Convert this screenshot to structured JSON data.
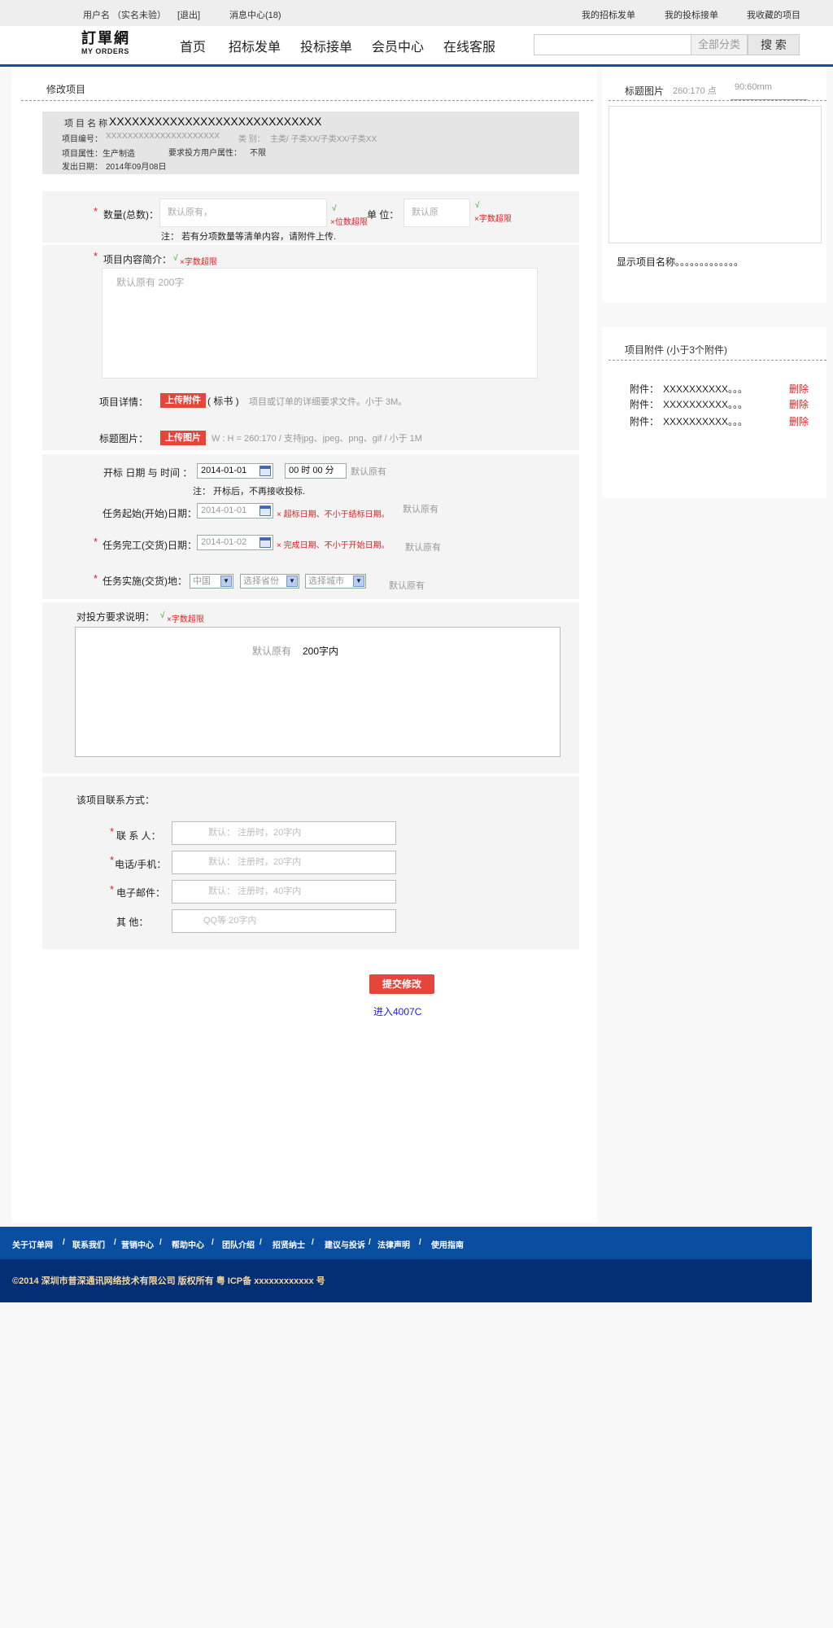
{
  "topbar": {
    "user": "用户名 （实名未验）",
    "logout": "[退出]",
    "messages": "消息中心(18)",
    "my_bids": "我的招标发单",
    "my_tenders": "我的投标接单",
    "favorites": "我收藏的项目"
  },
  "logo": {
    "cn": "訂單網",
    "en": "MY ORDERS"
  },
  "nav": {
    "home": "首页",
    "tender": "招标发单",
    "bid": "投标接单",
    "member": "会员中心",
    "service": "在线客服"
  },
  "search": {
    "placeholder": "",
    "category": "全部分类",
    "button": "搜 索"
  },
  "form": {
    "title": "修改项目",
    "info": {
      "name_label": "项 目 名 称",
      "name_value": "XXXXXXXXXXXXXXXXXXXXXXXXXXXX",
      "no_label": "项目编号：",
      "no_value": "XXXXXXXXXXXXXXXXXXXXX",
      "cat_label": "类 别：",
      "cat_value": "主类/ 子类XX/子类XX/子类XX",
      "attr_label": "项目属性：",
      "attr_value": "生产制造",
      "req_label": "要求投方用户属性：",
      "req_value": "不限",
      "date_label": "发出日期：",
      "date_value": "2014年09月08日"
    },
    "qty": {
      "label": "数量(总数)：",
      "placeholder": "默认原有，",
      "ok": "√",
      "err": "×位数超限",
      "unit_label": "单  位：",
      "unit_placeholder": "默认原",
      "unit_ok": "√",
      "unit_err": "×字数超限",
      "note": "注：  若有分项数量等清单内容，请附件上传."
    },
    "intro": {
      "label": "项目内容简介：",
      "ok": "√",
      "err": "×字数超限",
      "placeholder": "默认原有    200字"
    },
    "detail": {
      "label": "项目详情：",
      "button": "上传附件",
      "suffix": "( 标书 )",
      "hint": "项目或订单的详细要求文件。小于 3M。"
    },
    "image": {
      "label": "标题图片：",
      "button": "上传图片",
      "hint": "W : H = 260:170    / 支持jpg、jpeg、png、gif  /   小于 1M"
    },
    "bid_time": {
      "label": "开标 日期 与 时间 ：",
      "date": "2014-01-01",
      "time": "00 时 00 分",
      "default": "默认原有",
      "note": "注：  开标后，不再接收投标."
    },
    "start": {
      "label": "任务起始(开始)日期：",
      "date": "2014-01-01",
      "err": "× 超标日期、不小于结标日期。",
      "default": "默认原有"
    },
    "finish": {
      "label": "任务完工(交货)日期：",
      "date": "2014-01-02",
      "err": "× 完成日期、不小于开始日期。",
      "default": "默认原有"
    },
    "place": {
      "label": "任务实施(交货)地：",
      "country": "中国",
      "province": "选择省份",
      "city": "选择城市",
      "default": "默认原有"
    },
    "requirement": {
      "label": "对投方要求说明：",
      "ok": "√",
      "err": "×字数超限",
      "placeholder": "默认原有",
      "limit": "200字内"
    },
    "contact": {
      "title": "该项目联系方式：",
      "person": "联  系  人：",
      "person_ph": "默认：  注册时，20字内",
      "phone": "电话/手机：",
      "phone_ph": "默认：  注册时，20字内",
      "email": "电子邮件：",
      "email_ph": "默认：  注册时，40字内",
      "other": "其        他：",
      "other_ph": "QQ等 20字内"
    },
    "submit": "提交修改",
    "link": "进入4007C"
  },
  "side": {
    "image_title": "标题图片",
    "ratio": "260:170 点",
    "size": "90:60mm",
    "caption": "显示项目名称。。。。。。。。。。。。。",
    "attach_title": "项目附件 (小于3个附件)",
    "attachments": [
      {
        "label": "附件：",
        "name": "XXXXXXXXXX。。。",
        "del": "删除"
      },
      {
        "label": "附件：",
        "name": "XXXXXXXXXX。。。",
        "del": "删除"
      },
      {
        "label": "附件：",
        "name": "XXXXXXXXXX。。。",
        "del": "删除"
      }
    ]
  },
  "footer": {
    "links": [
      "关于订单网",
      "/",
      "联系我们",
      "/",
      "营销中心",
      "/",
      "帮助中心",
      "/",
      "团队介绍",
      "/",
      "招贤纳士",
      "/",
      "建议与投诉",
      "/",
      "法律声明",
      "/",
      "使用指南"
    ],
    "copyright": "©2014 深圳市普深通讯网络技术有限公司 版权所有 粤 ICP备 xxxxxxxxxxxx 号"
  }
}
